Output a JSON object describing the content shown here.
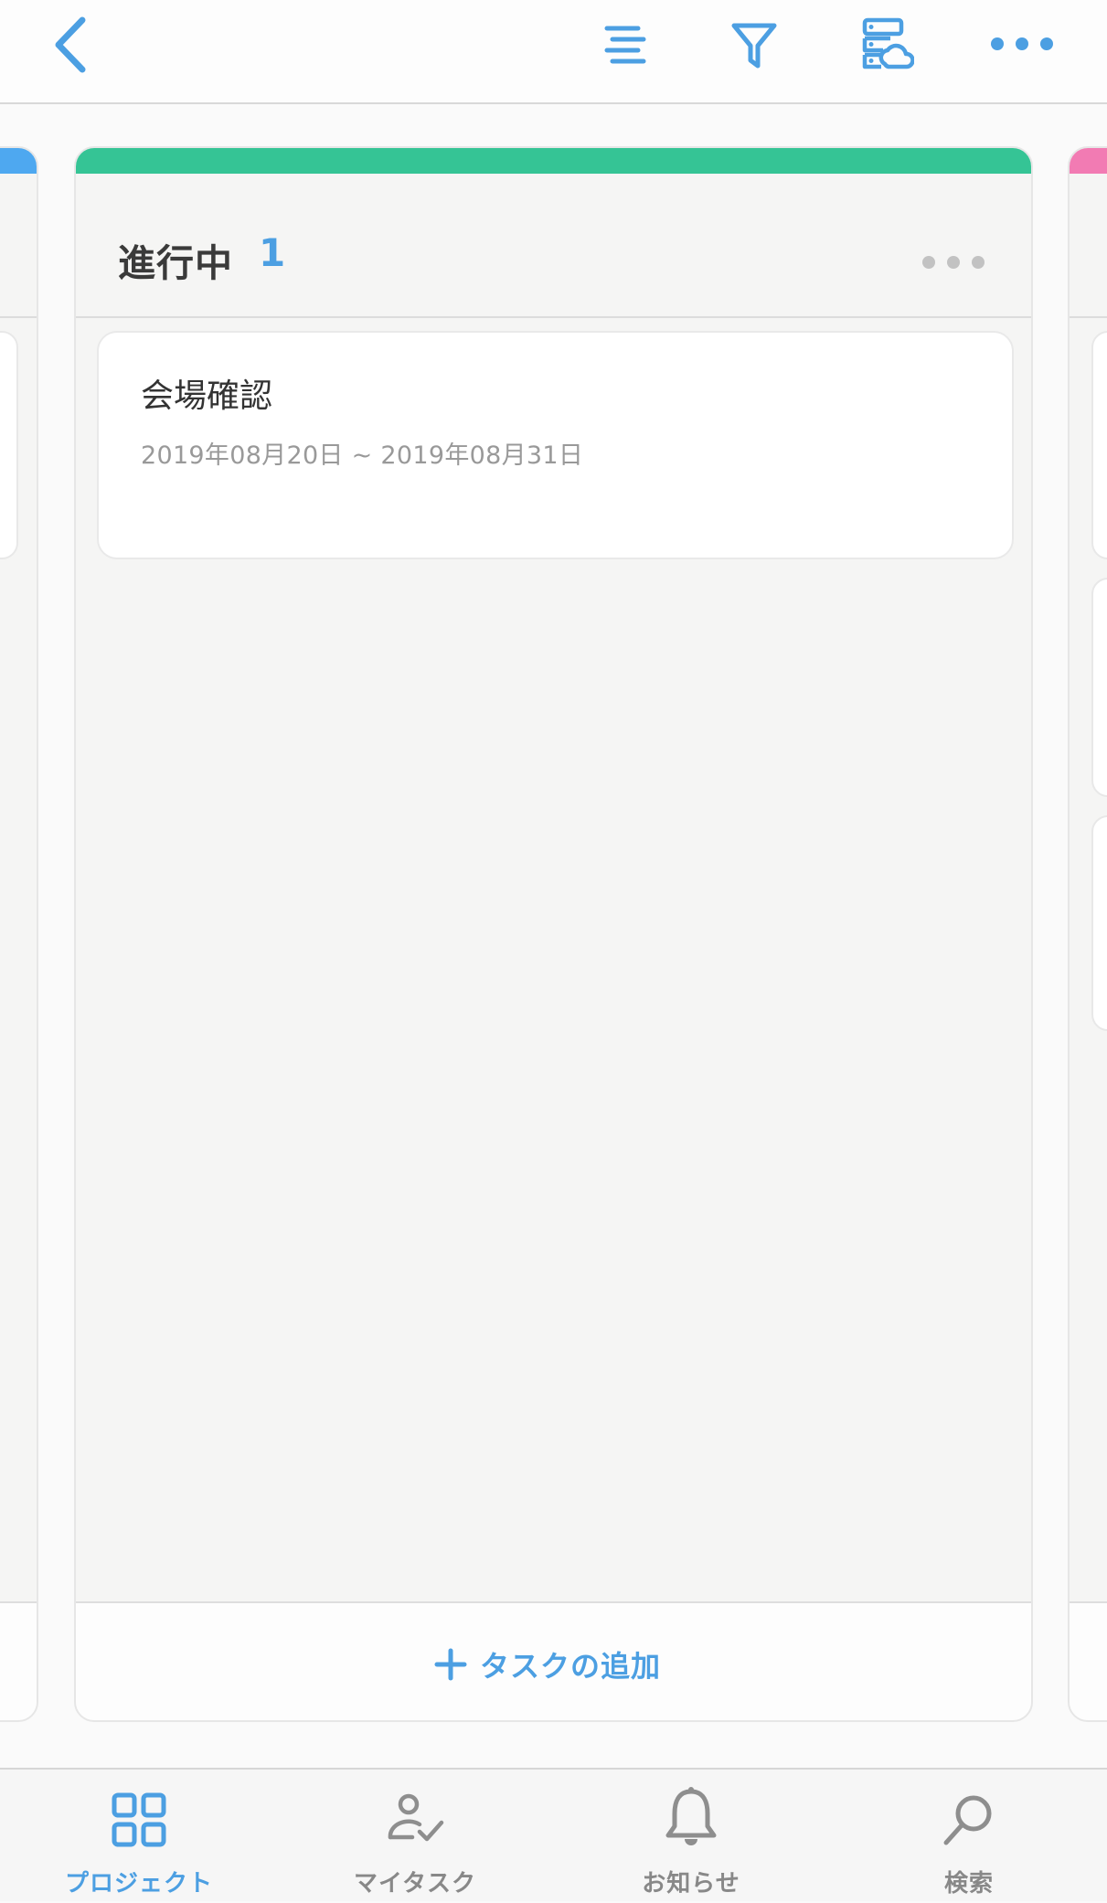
{
  "header": {
    "back_icon": "chevron-left-icon",
    "menu_icon": "list-align-icon",
    "filter_icon": "filter-icon",
    "storage_icon": "server-cloud-icon",
    "more_icon": "more-horizontal-icon",
    "accent_color": "#4c9fe2"
  },
  "board": {
    "columns": [
      {
        "stripe_color": "#4ea8f0"
      },
      {
        "title": "進行中",
        "count": "1",
        "stripe_color": "#35c495",
        "more_icon": "more-horizontal-icon",
        "tasks": [
          {
            "title": "会場確認",
            "date_range": "2019年08月20日 ~ 2019年08月31日"
          }
        ],
        "add_task_label": "タスクの追加",
        "add_icon": "plus-icon"
      },
      {
        "stripe_color": "#f27bb3"
      }
    ]
  },
  "tabbar": {
    "tabs": [
      {
        "label": "プロジェクト",
        "icon": "grid-icon",
        "active": true
      },
      {
        "label": "マイタスク",
        "icon": "person-check-icon",
        "active": false
      },
      {
        "label": "お知らせ",
        "icon": "bell-icon",
        "active": false
      },
      {
        "label": "検索",
        "icon": "search-icon",
        "active": false
      }
    ]
  }
}
